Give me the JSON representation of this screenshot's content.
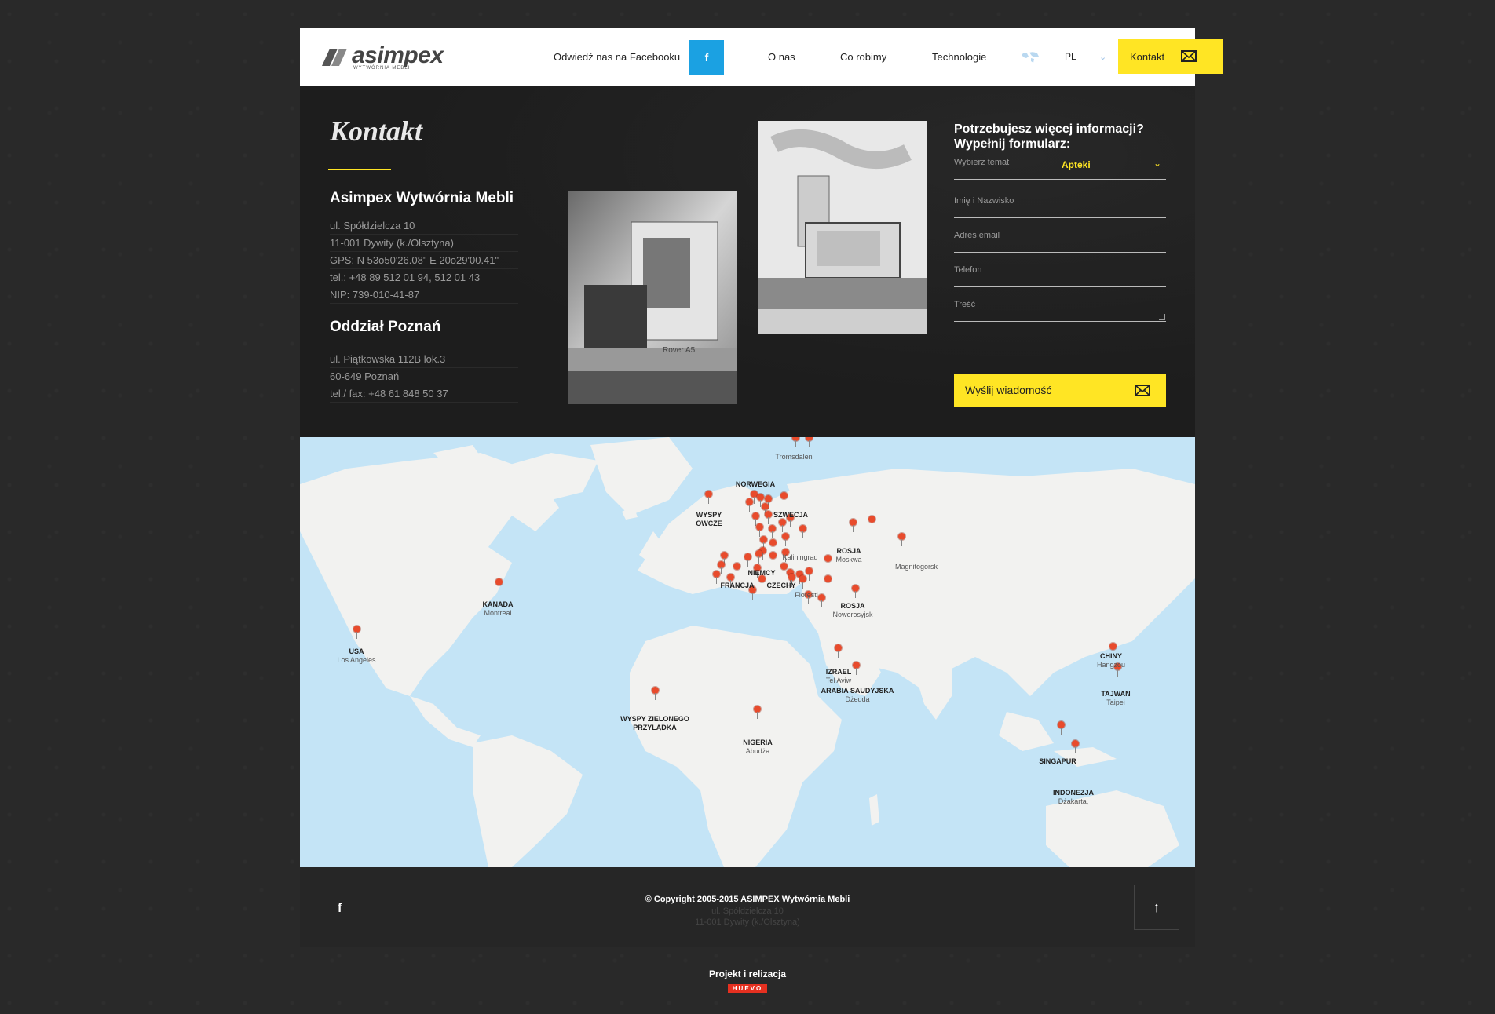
{
  "header": {
    "logo_text": "asimpex",
    "logo_sub": "WYTWÓRNIA MEBLI",
    "facebook_cta": "Odwiedź nas na Facebooku",
    "facebook_icon_text": "f",
    "nav": [
      {
        "label": "O nas"
      },
      {
        "label": "Co robimy"
      },
      {
        "label": "Technologie"
      }
    ],
    "language": "PL",
    "contact_button": "Kontakt"
  },
  "contact": {
    "title": "Kontakt",
    "company_name": "Asimpex Wytwórnia Mebli",
    "address_lines": [
      "ul. Spółdzielcza 10",
      "11-001 Dywity (k./Olsztyna)",
      "GPS: N 53o50'26.08\" E 20o29'00.41\"",
      "tel.: +48 89 512 01 94, 512 01 43",
      "NIP: 739-010-41-87"
    ],
    "branch_name": "Oddział Poznań",
    "branch_lines": [
      "ul. Piątkowska 112B lok.3",
      "60-649 Poznań",
      "tel./ fax: +48 61 848 50 37"
    ]
  },
  "form": {
    "title": "Potrzebujesz więcej informacji? Wypełnij formularz:",
    "topic_label": "Wybierz temat",
    "topic_value": "Apteki",
    "name_placeholder": "Imię i Nazwisko",
    "email_placeholder": "Adres email",
    "phone_placeholder": "Telefon",
    "message_placeholder": "Treść",
    "submit_label": "Wyślij wiadomość"
  },
  "map": {
    "labels": [
      {
        "country": "",
        "city": "Tromsdalen"
      },
      {
        "country": "NORWEGIA",
        "city": ""
      },
      {
        "country": "WYSPY",
        "city": "OWCZE"
      },
      {
        "country": "SZWECJA",
        "city": ""
      },
      {
        "country": "",
        "city": "Kaliningrad"
      },
      {
        "country": "ROSJA",
        "city": "Moskwa"
      },
      {
        "country": "",
        "city": "Magnitogorsk"
      },
      {
        "country": "NIEMCY",
        "city": ""
      },
      {
        "country": "FRANCJA",
        "city": ""
      },
      {
        "country": "CZECHY",
        "city": ""
      },
      {
        "country": "",
        "city": "Floresti"
      },
      {
        "country": "ROSJA",
        "city": "Noworosyjsk"
      },
      {
        "country": "KANADA",
        "city": "Montreal"
      },
      {
        "country": "USA",
        "city": "Los Angeles"
      },
      {
        "country": "CHINY",
        "city": "Hangzou"
      },
      {
        "country": "TAJWAN",
        "city": "Taipei"
      },
      {
        "country": "IZRAEL",
        "city": "Tel Aviw"
      },
      {
        "country": "ARABIA SAUDYJSKA",
        "city": "Dżedda"
      },
      {
        "country": "WYSPY ZIELONEGO",
        "city": "PRZYLĄDKA"
      },
      {
        "country": "NIGERIA",
        "city": "Abudża"
      },
      {
        "country": "SINGAPUR",
        "city": ""
      },
      {
        "country": "INDONEZJA",
        "city": "Dżakarta,"
      }
    ]
  },
  "footer": {
    "facebook_icon_text": "f",
    "copyright": "© Copyright 2005-2015 ASIMPEX Wytwórnia Mebli",
    "address_line1": "ul. Spółdzielcza 10",
    "address_line2": "11-001 Dywity (k./Olsztyna)",
    "to_top_icon": "↑"
  },
  "credits": {
    "label": "Projekt i relizacja",
    "agency": "HUEVO"
  },
  "colors": {
    "accent": "#ffe524",
    "facebook": "#1ba1e2",
    "pin": "#e84b2c",
    "ocean": "#c4e4f6"
  }
}
